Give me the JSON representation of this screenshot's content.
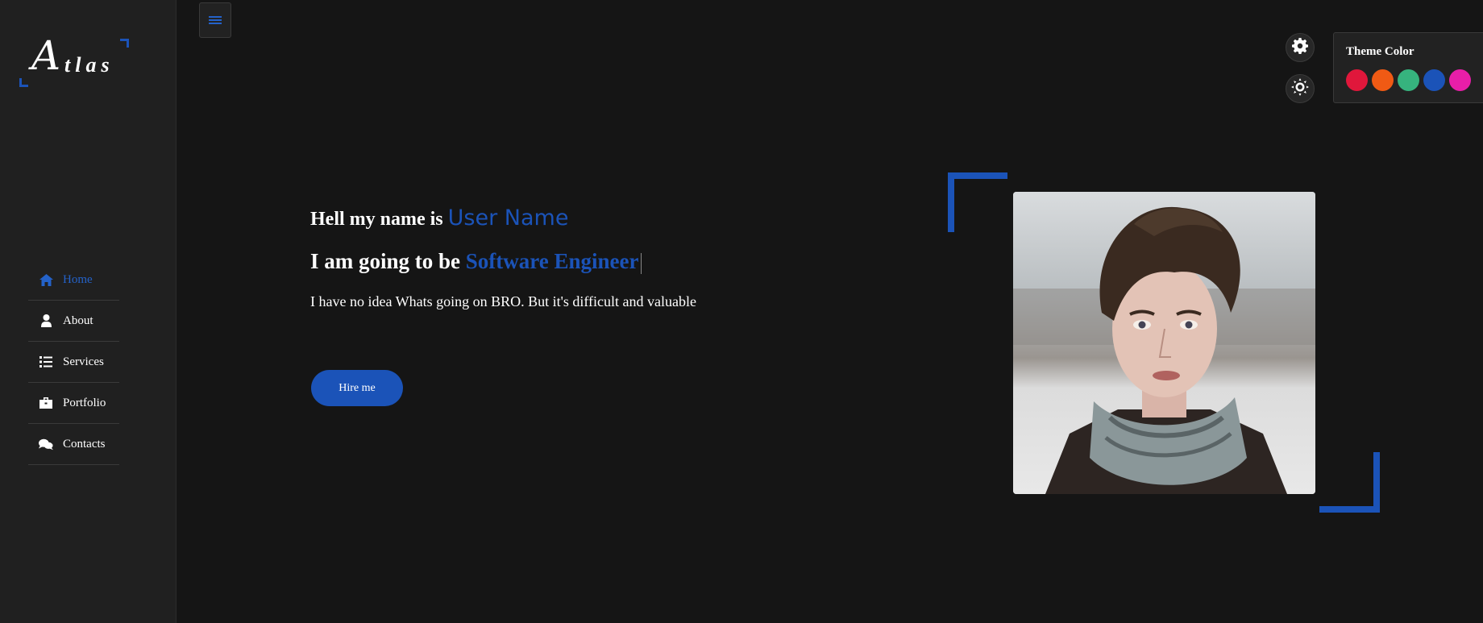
{
  "logo": {
    "first": "A",
    "rest": "tlas"
  },
  "nav": {
    "items": [
      {
        "label": "Home",
        "icon": "home-icon",
        "active": true
      },
      {
        "label": "About",
        "icon": "user-icon"
      },
      {
        "label": "Services",
        "icon": "list-icon"
      },
      {
        "label": "Portfolio",
        "icon": "briefcase-icon"
      },
      {
        "label": "Contacts",
        "icon": "comments-icon"
      }
    ]
  },
  "hero": {
    "greeting": "Hell my name is",
    "name": "User Name",
    "role_prefix": "I am going to be",
    "role": "Software Engineer",
    "description": "I have no idea Whats going on BRO. But it's difficult and valuable",
    "cta": "Hire me"
  },
  "theme": {
    "title": "Theme Color",
    "accent": "#1b53b8",
    "swatches": [
      "#e0173b",
      "#f05a14",
      "#36b37e",
      "#1b53b8",
      "#e81ea8"
    ]
  }
}
